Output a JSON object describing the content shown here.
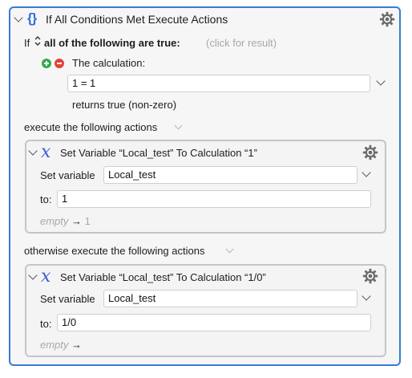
{
  "header": {
    "icon": "curly-braces-icon",
    "title": "If All Conditions Met Execute Actions"
  },
  "condition": {
    "if_label": "If",
    "mode": "all of the following are true:",
    "result_hint": "(click for result)",
    "calc_label": "The calculation:",
    "calc_value": "1 = 1",
    "returns_text": "returns true (non-zero)"
  },
  "then_section": {
    "label": "execute the following actions",
    "action": {
      "title": "Set Variable “Local_test” To Calculation “1”",
      "set_variable_label": "Set variable",
      "variable_value": "Local_test",
      "to_label": "to:",
      "to_value": "1",
      "result_empty": "empty",
      "result_arrow": "→",
      "result_value": "1"
    }
  },
  "else_section": {
    "label": "otherwise execute the following actions",
    "action": {
      "title": "Set Variable “Local_test” To Calculation “1/0”",
      "set_variable_label": "Set variable",
      "variable_value": "Local_test",
      "to_label": "to:",
      "to_value": "1/0",
      "result_empty": "empty",
      "result_arrow": "→",
      "result_value": ""
    }
  },
  "colors": {
    "accent": "#3a7bd5",
    "add_button": "#34a853",
    "remove_button": "#e0453a"
  }
}
